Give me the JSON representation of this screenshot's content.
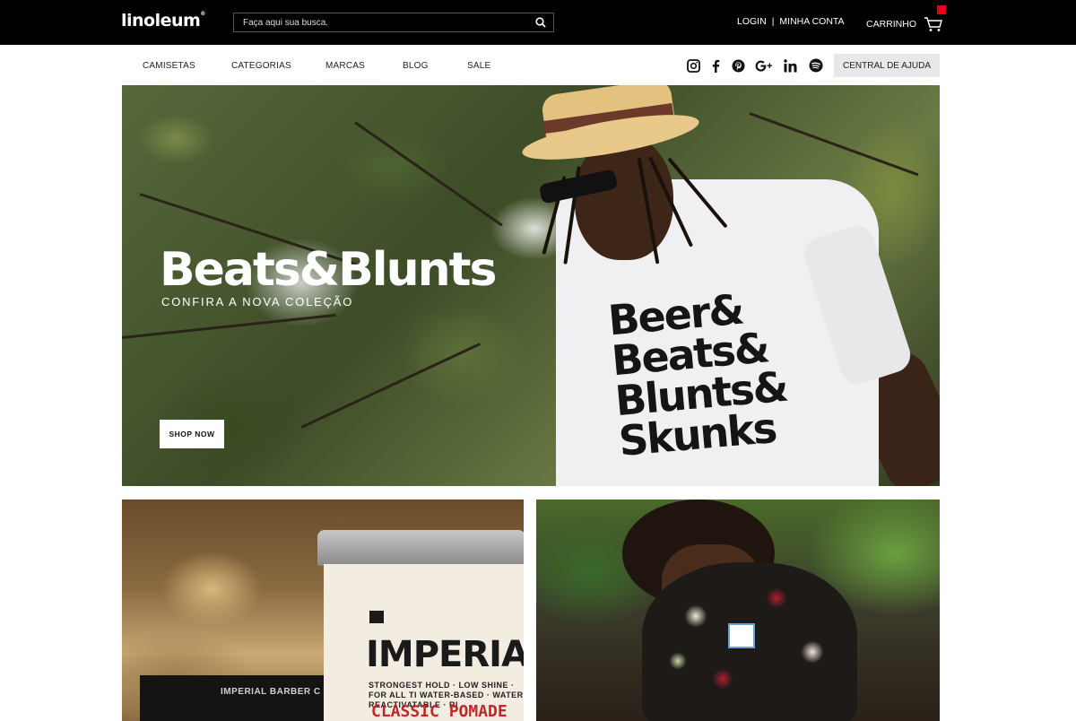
{
  "header": {
    "logo": "linoleum",
    "logo_mark": "®",
    "search": {
      "placeholder": "Faça aqui sua busca."
    },
    "account": {
      "login": "LOGIN",
      "separator": "|",
      "my_account": "MINHA CONTA"
    },
    "cart": {
      "label": "CARRINHO"
    }
  },
  "nav": {
    "items": [
      {
        "label": "CAMISETAS"
      },
      {
        "label": "CATEGORIAS"
      },
      {
        "label": "MARCAS"
      },
      {
        "label": "BLOG"
      },
      {
        "label": "SALE"
      }
    ],
    "social": [
      "instagram-icon",
      "facebook-icon",
      "pinterest-icon",
      "google-plus-icon",
      "linkedin-icon",
      "spotify-icon"
    ],
    "help_label": "CENTRAL DE AJUDA"
  },
  "hero": {
    "title": "Beats&Blunts",
    "subtitle": "CONFIRA A NOVA COLEÇÃO",
    "cta": "SHOP NOW",
    "shirt_lines": [
      "Beer&",
      "Beats&",
      "Blunts&",
      "Skunks"
    ]
  },
  "promo_left": {
    "brand": "IMPERIAL",
    "tagline": "STRONGEST HOLD · LOW SHINE · FOR ALL TI WATER-BASED · WATER REACTIVATABLE · RI",
    "product": "CLASSIC POMADE",
    "comb_text": "IMPERIAL BARBER C"
  },
  "colors": {
    "topbar": "#000000",
    "accent_red": "#e2001a",
    "help_bg": "#e8e8e8"
  }
}
